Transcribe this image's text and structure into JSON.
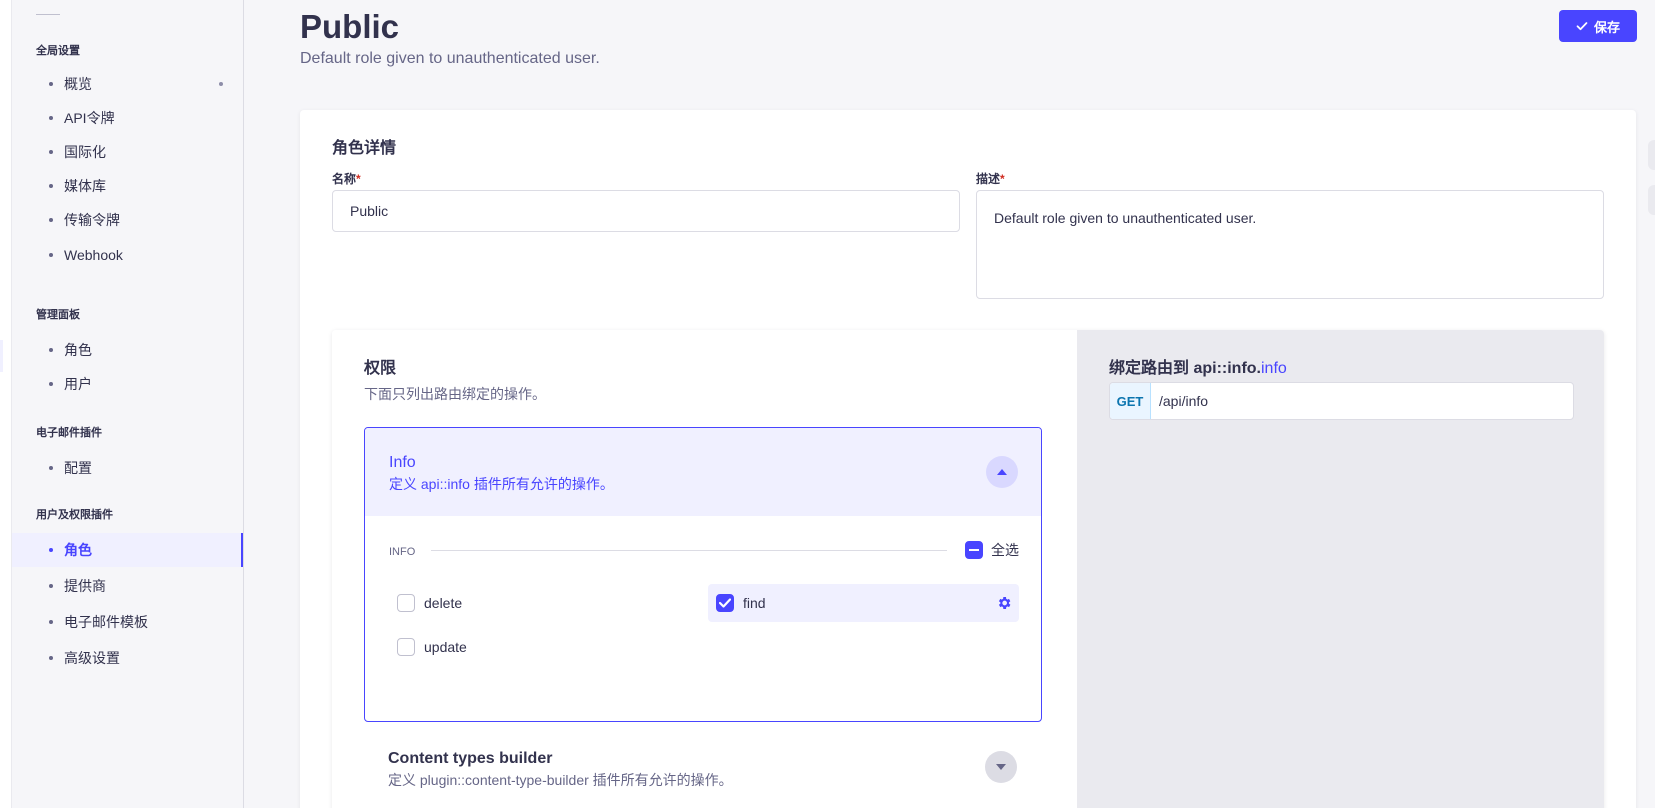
{
  "sidebar": {
    "sections": [
      {
        "title": "全局设置",
        "items": [
          {
            "label": "概览",
            "badge": true
          },
          {
            "label": "API令牌"
          },
          {
            "label": "国际化"
          },
          {
            "label": "媒体库"
          },
          {
            "label": "传输令牌"
          },
          {
            "label": "Webhook"
          }
        ]
      },
      {
        "title": "管理面板",
        "items": [
          {
            "label": "角色"
          },
          {
            "label": "用户"
          }
        ]
      },
      {
        "title": "电子邮件插件",
        "items": [
          {
            "label": "配置"
          }
        ]
      },
      {
        "title": "用户及权限插件",
        "items": [
          {
            "label": "角色",
            "active": true
          },
          {
            "label": "提供商"
          },
          {
            "label": "电子邮件模板"
          },
          {
            "label": "高级设置"
          }
        ]
      }
    ]
  },
  "header": {
    "title": "Public",
    "subtitle": "Default role given to unauthenticated user.",
    "save_label": "保存"
  },
  "role_details": {
    "title": "角色详情",
    "name_label": "名称",
    "name_value": "Public",
    "description_label": "描述",
    "description_value": "Default role given to unauthenticated user.",
    "required_mark": "*"
  },
  "permissions": {
    "title": "权限",
    "subtitle": "下面只列出路由绑定的操作。",
    "accordions": [
      {
        "name": "Info",
        "description": "定义 api::info 插件所有允许的操作。",
        "expanded": true,
        "group_label": "INFO",
        "select_all_label": "全选",
        "select_all_state": "indeterminate",
        "actions": [
          {
            "label": "delete",
            "checked": false
          },
          {
            "label": "find",
            "checked": true,
            "highlighted": true
          },
          {
            "label": "update",
            "checked": false
          }
        ]
      },
      {
        "name": "Content types builder",
        "description": "定义 plugin::content-type-builder 插件所有允许的操作。",
        "expanded": false
      }
    ]
  },
  "bound_route": {
    "title_prefix": "绑定路由到 api::info.",
    "title_accent": "info",
    "method": "GET",
    "path": "/api/info"
  },
  "colors": {
    "primary": "#4945ff",
    "background": "#f6f6f9",
    "text": "#32324d",
    "muted": "#666687",
    "required": "#d02b20"
  }
}
